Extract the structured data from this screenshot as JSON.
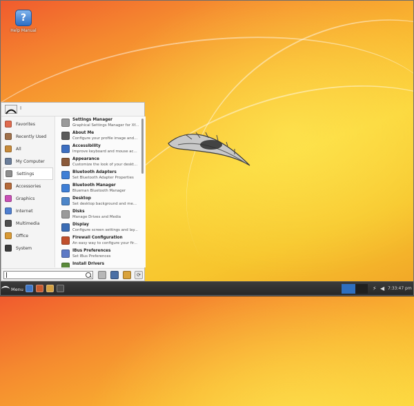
{
  "desktop": {
    "icons": [
      {
        "label": "Help Manual",
        "glyph": "?",
        "icon": "help-icon"
      }
    ]
  },
  "menu": {
    "user": {
      "name": "I"
    },
    "categories": [
      {
        "label": "Favorites",
        "icon": "favorites-icon",
        "color": "#e06b4e"
      },
      {
        "label": "Recently Used",
        "icon": "recent-icon",
        "color": "#a0714a"
      },
      {
        "label": "All",
        "icon": "all-apps-icon",
        "color": "#c88b3a"
      },
      {
        "label": "My Computer",
        "icon": "computer-icon",
        "color": "#6b7e9a"
      },
      {
        "label": "Settings",
        "icon": "settings-icon",
        "color": "#8e8e8e",
        "active": true
      },
      {
        "label": "Accessories",
        "icon": "accessories-icon",
        "color": "#b56a3a"
      },
      {
        "label": "Graphics",
        "icon": "graphics-icon",
        "color": "#c94fb6"
      },
      {
        "label": "Internet",
        "icon": "internet-icon",
        "color": "#4f7fd0"
      },
      {
        "label": "Multimedia",
        "icon": "multimedia-icon",
        "color": "#4e4e4e"
      },
      {
        "label": "Office",
        "icon": "office-icon",
        "color": "#d99a35"
      },
      {
        "label": "System",
        "icon": "system-icon",
        "color": "#3c3c3c"
      }
    ],
    "apps": [
      {
        "title": "Settings Manager",
        "desc": "Graphical Settings Manager for Xf...",
        "icon": "settings-manager-icon",
        "color": "#9a9a9a"
      },
      {
        "title": "About Me",
        "desc": "Configure your profile image and...",
        "icon": "about-me-icon",
        "color": "#5a5a5a"
      },
      {
        "title": "Accessibility",
        "desc": "Improve keyboard and mouse ac...",
        "icon": "accessibility-icon",
        "color": "#3d6fc1"
      },
      {
        "title": "Appearance",
        "desc": "Customize the look of your deskt...",
        "icon": "appearance-icon",
        "color": "#8b5a3a"
      },
      {
        "title": "Bluetooth Adapters",
        "desc": "Set Bluetooth Adapter Properties",
        "icon": "bluetooth-adapter-icon",
        "color": "#3f7fd6"
      },
      {
        "title": "Bluetooth Manager",
        "desc": "Blueman Bluetooth Manager",
        "icon": "bluetooth-manager-icon",
        "color": "#3f7fd6"
      },
      {
        "title": "Desktop",
        "desc": "Set desktop background and me...",
        "icon": "desktop-settings-icon",
        "color": "#4d86c9"
      },
      {
        "title": "Disks",
        "desc": "Manage Drives and Media",
        "icon": "disks-icon",
        "color": "#9a9a9a"
      },
      {
        "title": "Display",
        "desc": "Configure screen settings and lay...",
        "icon": "display-icon",
        "color": "#3b6db5"
      },
      {
        "title": "Firewall Configuration",
        "desc": "An easy way to configure your fir...",
        "icon": "firewall-icon",
        "color": "#c0502d"
      },
      {
        "title": "IBus Preferences",
        "desc": "Set IBus Preferences",
        "icon": "ibus-icon",
        "color": "#5d79c5"
      },
      {
        "title": "Install Drivers",
        "desc": "",
        "icon": "install-drivers-icon",
        "color": "#5a8a3a"
      }
    ],
    "search": {
      "placeholder": "",
      "value": ""
    },
    "system_buttons": [
      {
        "icon": "applications-icon",
        "color": "#b7b7b7"
      },
      {
        "icon": "monitor-icon",
        "color": "#4a6fa5"
      },
      {
        "icon": "lock-icon",
        "color": "#d9a23a"
      },
      {
        "icon": "logout-icon",
        "color": "#e6e6e6",
        "glyph": "⟳"
      }
    ]
  },
  "taskbar": {
    "menu_label": "Menu",
    "launchers": [
      {
        "icon": "terminal-launcher-icon",
        "color": "#3e76c6"
      },
      {
        "icon": "web-browser-icon",
        "color": "#c65a2e"
      },
      {
        "icon": "file-manager-icon",
        "color": "#d3a043"
      },
      {
        "icon": "console-icon",
        "color": "#4a4a4a"
      }
    ],
    "workspaces": [
      {
        "label": "",
        "active": true,
        "color": "#2f6fbf"
      },
      {
        "label": "",
        "active": false,
        "color": "#1f1f1f"
      }
    ],
    "tray": [
      {
        "icon": "network-icon",
        "glyph": "⚡"
      },
      {
        "icon": "volume-icon",
        "glyph": "◀"
      }
    ],
    "clock": "7:33:47 pm"
  }
}
